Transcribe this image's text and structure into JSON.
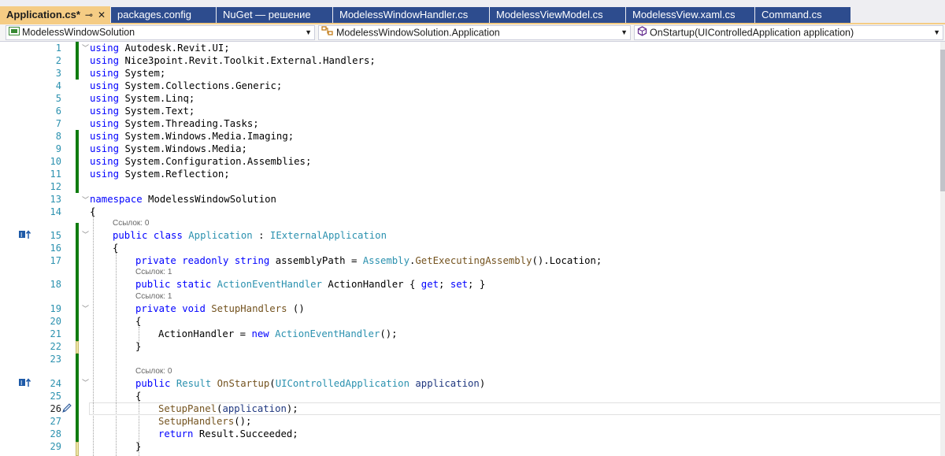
{
  "tabs": [
    {
      "label": "Application.cs*",
      "pin": "⊸",
      "close": "✕"
    },
    {
      "label": "packages.config"
    },
    {
      "label": "NuGet — решение"
    },
    {
      "label": "ModelessWindowHandler.cs"
    },
    {
      "label": "ModelessViewModel.cs"
    },
    {
      "label": "ModelessView.xaml.cs"
    },
    {
      "label": "Command.cs"
    }
  ],
  "navbar": {
    "project": "ModelessWindowSolution",
    "class": "ModelessWindowSolution.Application",
    "member": "OnStartup(UIControlledApplication application)"
  },
  "lens": {
    "l15": "Ссылок: 0",
    "l18": "Ссылок: 1",
    "l19": "Ссылок: 1",
    "l24": "Ссылок: 0"
  },
  "lines": {
    "n1": "1",
    "n2": "2",
    "n3": "3",
    "n4": "4",
    "n5": "5",
    "n6": "6",
    "n7": "7",
    "n8": "8",
    "n9": "9",
    "n10": "10",
    "n11": "11",
    "n12": "12",
    "n13": "13",
    "n14": "14",
    "n15": "15",
    "n16": "16",
    "n17": "17",
    "n18": "18",
    "n19": "19",
    "n20": "20",
    "n21": "21",
    "n22": "22",
    "n23": "23",
    "n24": "24",
    "n25": "25",
    "n26": "26",
    "n27": "27",
    "n28": "28",
    "n29": "29"
  },
  "code": {
    "kw_using": "using",
    "kw_namespace": "namespace",
    "kw_public": "public",
    "kw_class": "class",
    "kw_private": "private",
    "kw_readonly": "readonly",
    "kw_string": "string",
    "kw_static": "static",
    "kw_get": "get",
    "kw_set": "set",
    "kw_void": "void",
    "kw_new": "new",
    "kw_return": "return",
    "u1": "Autodesk.Revit.UI;",
    "u2": "Nice3point.Revit.Toolkit.External.Handlers;",
    "u3": "System;",
    "u4": "System.Collections.Generic;",
    "u5": "System.Linq;",
    "u6": "System.Text;",
    "u7": "System.Threading.Tasks;",
    "u8": "System.Windows.Media.Imaging;",
    "u9": "System.Windows.Media;",
    "u10": "System.Configuration.Assemblies;",
    "u11": "System.Reflection;",
    "ns_name": "ModelessWindowSolution",
    "brace_open": "{",
    "brace_close": "}",
    "cls_name": "Application",
    "colon": ":",
    "iface": "IExternalApplication",
    "field_name": "assemblyPath",
    "eq": "=",
    "assembly": "Assembly",
    "dot": ".",
    "get_exec": "GetExecutingAssembly",
    "paren_pair": "()",
    "location": ".Location;",
    "aeh": "ActionEventHandler",
    "action_handler": "ActionHandler",
    "prop_open": "{",
    "semi": ";",
    "prop_close": "}",
    "setup_handlers": "SetupHandlers",
    "space_paren": " ()",
    "ah_assign": "ActionHandler =",
    "aeh_ctor_end": "();",
    "result": "Result",
    "on_startup": "OnStartup",
    "paren_open": "(",
    "uica": "UIControlledApplication",
    "param_app": "application",
    "paren_close": ")",
    "setup_panel": "SetupPanel",
    "paren_app_end": ");",
    "call_end": "();",
    "result_succeeded": "Result.Succeeded;"
  },
  "colors": {
    "keyword": "#0000ff",
    "type": "#2b91af",
    "method": "#74531f",
    "param": "#1f377f",
    "changed": "#107c10",
    "active_tab": "#f5cc84",
    "tab": "#2d4c8e"
  },
  "icons": [
    "csharp-project-icon",
    "class-icon",
    "method-icon",
    "implements-icon",
    "pencil-icon"
  ]
}
